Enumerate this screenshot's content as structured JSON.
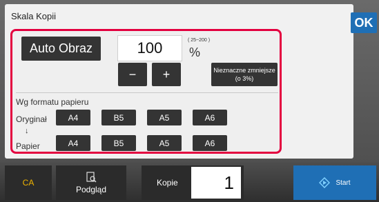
{
  "panel": {
    "title": "Skala Kopii",
    "ok_label": "OK"
  },
  "scale": {
    "auto_label": "Auto Obraz",
    "value": "100",
    "range": "( 25~200 )",
    "unit": "%",
    "minus": "−",
    "plus": "+",
    "small_reduce_line1": "Nieznaczne zmniejsze",
    "small_reduce_line2": "(o 3%)"
  },
  "paper_format": {
    "section_label": "Wg formatu papieru",
    "original_label": "Oryginał",
    "arrow": "↓",
    "paper_label": "Papier",
    "original_sizes": [
      "A4",
      "B5",
      "A5",
      "A6"
    ],
    "paper_sizes": [
      "A4",
      "B5",
      "A5",
      "A6"
    ]
  },
  "bottom_bar": {
    "ca_label": "CA",
    "preview_label": "Podgląd",
    "copies_label": "Kopie",
    "copies_value": "1",
    "start_label": "Start"
  },
  "colors": {
    "accent": "#1f6fb5",
    "highlight_border": "#e3003f",
    "ca_text": "#f0b400"
  }
}
